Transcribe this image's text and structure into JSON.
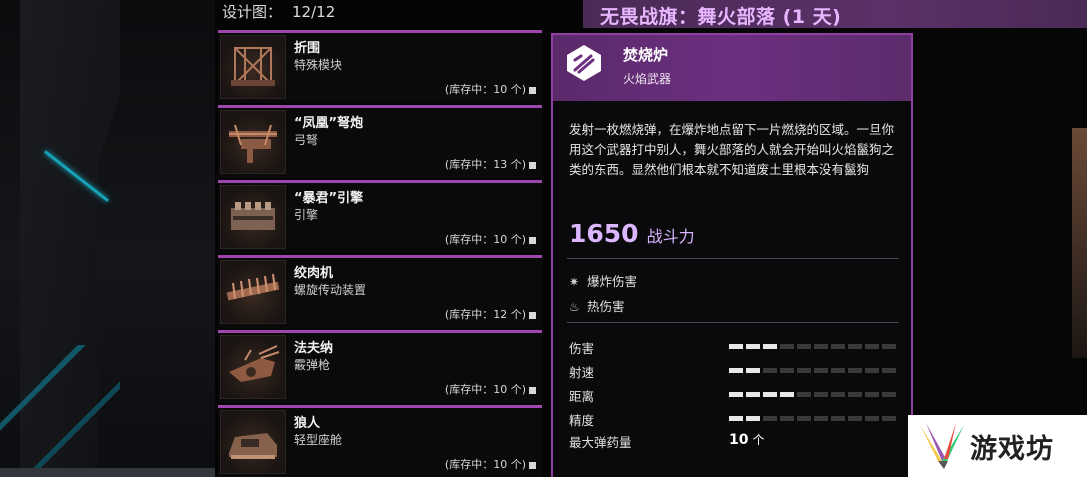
{
  "banner": {
    "title": "无畏战旗：舞火部落 (1 天)"
  },
  "blueprints": {
    "label": "设计图：",
    "count": "12/12"
  },
  "items": [
    {
      "name": "折围",
      "type": "特殊模块",
      "stock": "(库存中：10 个)",
      "icon": "cage-module-icon"
    },
    {
      "name": "“凤凰”弩炮",
      "type": "弓弩",
      "stock": "(库存中：13 个)",
      "icon": "ballista-icon"
    },
    {
      "name": "“暴君”引擎",
      "type": "引擎",
      "stock": "(库存中：10 个)",
      "icon": "engine-icon"
    },
    {
      "name": "绞肉机",
      "type": "螺旋传动装置",
      "stock": "(库存中：12 个)",
      "icon": "grinder-icon"
    },
    {
      "name": "法夫纳",
      "type": "霰弹枪",
      "stock": "(库存中：10 个)",
      "icon": "shotgun-icon"
    },
    {
      "name": "狼人",
      "type": "轻型座舱",
      "stock": "(库存中：10 个)",
      "icon": "cabin-icon"
    }
  ],
  "detail": {
    "title": "焚烧炉",
    "subtitle": "火焰武器",
    "icon": "fire-weapon-icon",
    "description": "发射一枚燃烧弹，在爆炸地点留下一片燃烧的区域。一旦你用这个武器打中别人，舞火部落的人就会开始叫火焰鬣狗之类的东西。显然他们根本就不知道废土里根本没有鬣狗",
    "power_value": "1650",
    "power_label": "战斗力",
    "tags": [
      {
        "icon": "explosion-icon",
        "label": "爆炸伤害"
      },
      {
        "icon": "fire-icon",
        "label": "热伤害"
      }
    ],
    "stats": [
      {
        "label": "伤害",
        "level": 0.3
      },
      {
        "label": "射速",
        "level": 0.2
      },
      {
        "label": "距离",
        "level": 0.4
      },
      {
        "label": "精度",
        "level": 0.2
      },
      {
        "label": "最大弹药量",
        "value": "10",
        "unit": "个"
      }
    ]
  },
  "watermark": {
    "text": "游戏坊"
  },
  "colors": {
    "accent": "#9e46ad",
    "banner_text": "#e7b6ff",
    "power_text": "#dcb6ff"
  }
}
